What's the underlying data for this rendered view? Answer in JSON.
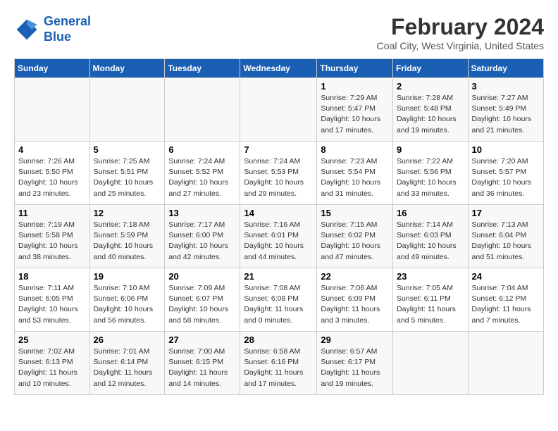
{
  "logo": {
    "line1": "General",
    "line2": "Blue"
  },
  "title": "February 2024",
  "subtitle": "Coal City, West Virginia, United States",
  "days_header": [
    "Sunday",
    "Monday",
    "Tuesday",
    "Wednesday",
    "Thursday",
    "Friday",
    "Saturday"
  ],
  "weeks": [
    [
      {
        "day": "",
        "info": ""
      },
      {
        "day": "",
        "info": ""
      },
      {
        "day": "",
        "info": ""
      },
      {
        "day": "",
        "info": ""
      },
      {
        "day": "1",
        "info": "Sunrise: 7:29 AM\nSunset: 5:47 PM\nDaylight: 10 hours\nand 17 minutes."
      },
      {
        "day": "2",
        "info": "Sunrise: 7:28 AM\nSunset: 5:48 PM\nDaylight: 10 hours\nand 19 minutes."
      },
      {
        "day": "3",
        "info": "Sunrise: 7:27 AM\nSunset: 5:49 PM\nDaylight: 10 hours\nand 21 minutes."
      }
    ],
    [
      {
        "day": "4",
        "info": "Sunrise: 7:26 AM\nSunset: 5:50 PM\nDaylight: 10 hours\nand 23 minutes."
      },
      {
        "day": "5",
        "info": "Sunrise: 7:25 AM\nSunset: 5:51 PM\nDaylight: 10 hours\nand 25 minutes."
      },
      {
        "day": "6",
        "info": "Sunrise: 7:24 AM\nSunset: 5:52 PM\nDaylight: 10 hours\nand 27 minutes."
      },
      {
        "day": "7",
        "info": "Sunrise: 7:24 AM\nSunset: 5:53 PM\nDaylight: 10 hours\nand 29 minutes."
      },
      {
        "day": "8",
        "info": "Sunrise: 7:23 AM\nSunset: 5:54 PM\nDaylight: 10 hours\nand 31 minutes."
      },
      {
        "day": "9",
        "info": "Sunrise: 7:22 AM\nSunset: 5:56 PM\nDaylight: 10 hours\nand 33 minutes."
      },
      {
        "day": "10",
        "info": "Sunrise: 7:20 AM\nSunset: 5:57 PM\nDaylight: 10 hours\nand 36 minutes."
      }
    ],
    [
      {
        "day": "11",
        "info": "Sunrise: 7:19 AM\nSunset: 5:58 PM\nDaylight: 10 hours\nand 38 minutes."
      },
      {
        "day": "12",
        "info": "Sunrise: 7:18 AM\nSunset: 5:59 PM\nDaylight: 10 hours\nand 40 minutes."
      },
      {
        "day": "13",
        "info": "Sunrise: 7:17 AM\nSunset: 6:00 PM\nDaylight: 10 hours\nand 42 minutes."
      },
      {
        "day": "14",
        "info": "Sunrise: 7:16 AM\nSunset: 6:01 PM\nDaylight: 10 hours\nand 44 minutes."
      },
      {
        "day": "15",
        "info": "Sunrise: 7:15 AM\nSunset: 6:02 PM\nDaylight: 10 hours\nand 47 minutes."
      },
      {
        "day": "16",
        "info": "Sunrise: 7:14 AM\nSunset: 6:03 PM\nDaylight: 10 hours\nand 49 minutes."
      },
      {
        "day": "17",
        "info": "Sunrise: 7:13 AM\nSunset: 6:04 PM\nDaylight: 10 hours\nand 51 minutes."
      }
    ],
    [
      {
        "day": "18",
        "info": "Sunrise: 7:11 AM\nSunset: 6:05 PM\nDaylight: 10 hours\nand 53 minutes."
      },
      {
        "day": "19",
        "info": "Sunrise: 7:10 AM\nSunset: 6:06 PM\nDaylight: 10 hours\nand 56 minutes."
      },
      {
        "day": "20",
        "info": "Sunrise: 7:09 AM\nSunset: 6:07 PM\nDaylight: 10 hours\nand 58 minutes."
      },
      {
        "day": "21",
        "info": "Sunrise: 7:08 AM\nSunset: 6:08 PM\nDaylight: 11 hours\nand 0 minutes."
      },
      {
        "day": "22",
        "info": "Sunrise: 7:06 AM\nSunset: 6:09 PM\nDaylight: 11 hours\nand 3 minutes."
      },
      {
        "day": "23",
        "info": "Sunrise: 7:05 AM\nSunset: 6:11 PM\nDaylight: 11 hours\nand 5 minutes."
      },
      {
        "day": "24",
        "info": "Sunrise: 7:04 AM\nSunset: 6:12 PM\nDaylight: 11 hours\nand 7 minutes."
      }
    ],
    [
      {
        "day": "25",
        "info": "Sunrise: 7:02 AM\nSunset: 6:13 PM\nDaylight: 11 hours\nand 10 minutes."
      },
      {
        "day": "26",
        "info": "Sunrise: 7:01 AM\nSunset: 6:14 PM\nDaylight: 11 hours\nand 12 minutes."
      },
      {
        "day": "27",
        "info": "Sunrise: 7:00 AM\nSunset: 6:15 PM\nDaylight: 11 hours\nand 14 minutes."
      },
      {
        "day": "28",
        "info": "Sunrise: 6:58 AM\nSunset: 6:16 PM\nDaylight: 11 hours\nand 17 minutes."
      },
      {
        "day": "29",
        "info": "Sunrise: 6:57 AM\nSunset: 6:17 PM\nDaylight: 11 hours\nand 19 minutes."
      },
      {
        "day": "",
        "info": ""
      },
      {
        "day": "",
        "info": ""
      }
    ]
  ]
}
